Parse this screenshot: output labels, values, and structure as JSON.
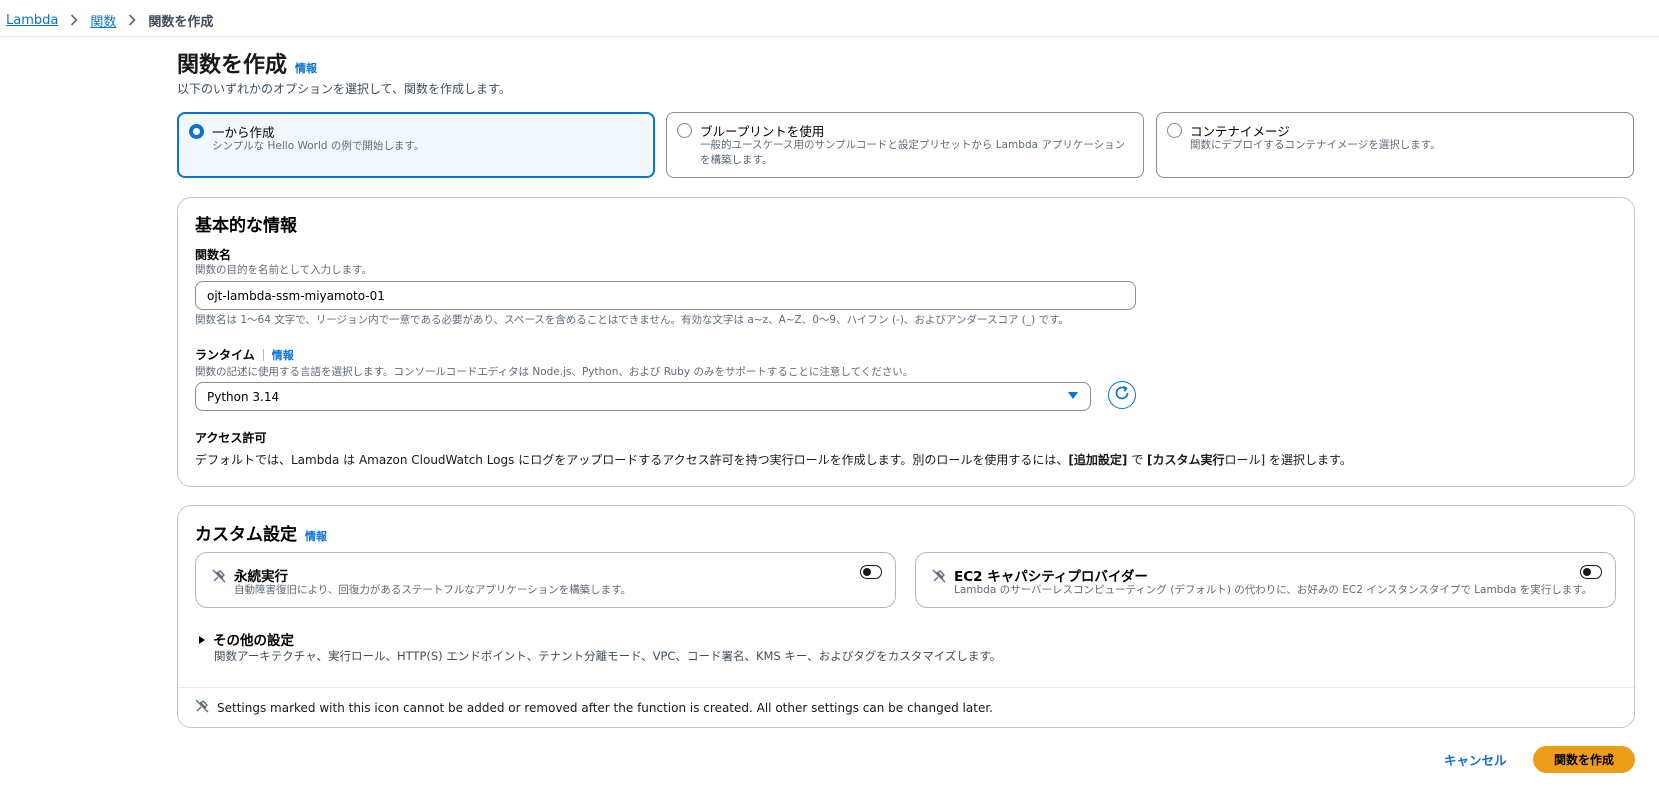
{
  "breadcrumb": {
    "items": [
      "Lambda",
      "関数"
    ],
    "current": "関数を作成"
  },
  "page": {
    "title": "関数を作成",
    "info": "情報",
    "description": "以下のいずれかのオプションを選択して、関数を作成します。"
  },
  "options": [
    {
      "title": "一から作成",
      "description": "シンプルな Hello World の例で開始します。",
      "selected": true
    },
    {
      "title": "ブループリントを使用",
      "description": "一般的ユースケース用のサンプルコードと設定プリセットから Lambda アプリケーションを構築します。",
      "selected": false
    },
    {
      "title": "コンテナイメージ",
      "description": "関数にデプロイするコンテナイメージを選択します。",
      "selected": false
    }
  ],
  "basic": {
    "heading": "基本的な情報",
    "function_name": {
      "label": "関数名",
      "description": "関数の目的を名前として入力します。",
      "value": "ojt-lambda-ssm-miyamoto-01",
      "constraint": "関数名は 1〜64 文字で、リージョン内で一意である必要があり、スペースを含めることはできません。有効な文字は a~z、A~Z、0〜9、ハイフン (-)、およびアンダースコア (_) です。"
    },
    "runtime": {
      "label": "ランタイム",
      "info": "情報",
      "description": "関数の記述に使用する言語を選択します。コンソールコードエディタは Node.js、Python、および Ruby のみをサポートすることに注意してください。",
      "value": "Python 3.14"
    },
    "access": {
      "label": "アクセス許可",
      "text_prefix": "デフォルトでは、Lambda は Amazon CloudWatch Logs にログをアップロードするアクセス許可を持つ実行ロールを作成します。別のロールを使用するには、",
      "bold1": "[追加設定]",
      "text_mid": " で ",
      "bold2": "[カスタム実行",
      "text_role": "ロール]",
      "text_suffix": " を選択します。"
    }
  },
  "custom": {
    "heading": "カスタム設定",
    "info": "情報",
    "durable": {
      "title": "永続実行",
      "description": "自動障害復旧により、回復力があるステートフルなアプリケーションを構築します。",
      "enabled": false
    },
    "ec2": {
      "title": "EC2 キャパシティプロバイダー",
      "description": "Lambda のサーバーレスコンピューティング (デフォルト) の代わりに、お好みの EC2 インスタンスタイプで Lambda を実行します。",
      "enabled": false
    },
    "other": {
      "title": "その他の設定",
      "description": "関数アーキテクチャ、実行ロール、HTTP(S) エンドポイント、テナント分離モード、VPC、コード署名、KMS キー、およびタグをカスタマイズします。"
    },
    "footnote": "Settings marked with this icon cannot be added or removed after the function is created. All other settings can be changed later."
  },
  "actions": {
    "cancel": "キャンセル",
    "create": "関数を作成"
  },
  "colors": {
    "accent": "#0972d3",
    "primary_button": "#ec9d19",
    "border": "#c6c6cd"
  },
  "icons": [
    "chevron-right-icon",
    "caret-down-icon",
    "refresh-icon",
    "lock-icon",
    "caret-right-icon"
  ]
}
